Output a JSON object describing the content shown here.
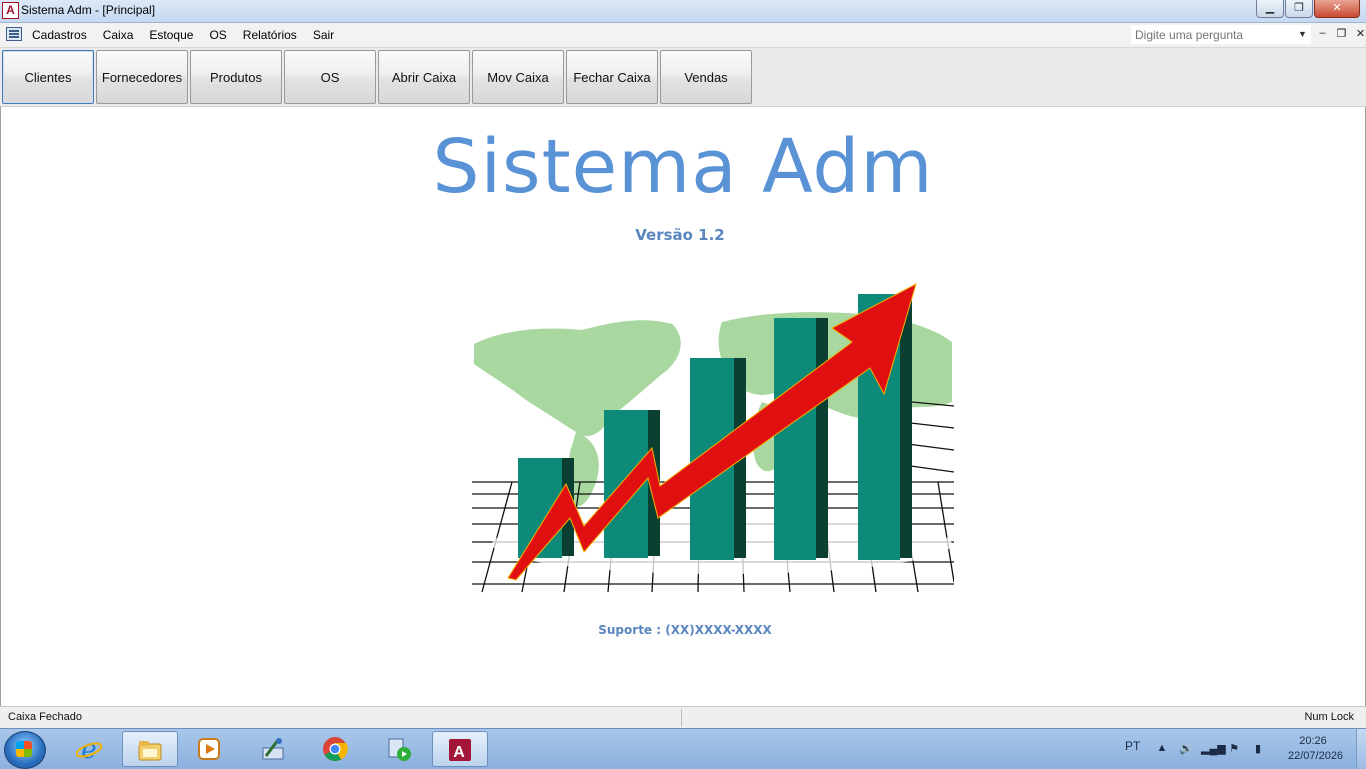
{
  "window": {
    "title": "Sistema Adm - [Principal]",
    "app_icon_letter": "A"
  },
  "menu": {
    "items": [
      "Cadastros",
      "Caixa",
      "Estoque",
      "OS",
      "Relatórios",
      "Sair"
    ],
    "ask_placeholder": "Digite uma pergunta"
  },
  "commands": {
    "buttons": [
      "Clientes",
      "Fornecedores",
      "Produtos",
      "OS",
      "Abrir Caixa",
      "Mov Caixa",
      "Fechar Caixa",
      "Vendas"
    ],
    "active": "Clientes"
  },
  "main": {
    "title": "Sistema Adm",
    "version": "Versão 1.2",
    "support": "Suporte : (XX)XXXX-XXXX",
    "image": "growth-chart-world-map",
    "colors": {
      "title": "#5a92d6",
      "bars": "#0e8a78",
      "arrow": "#e01010",
      "map": "#a8d8a0"
    }
  },
  "statusbar": {
    "left": "Caixa Fechado",
    "right": "Num Lock"
  },
  "taskbar": {
    "apps": [
      "internet-explorer-icon",
      "file-explorer-icon",
      "media-player-icon",
      "control-panel-icon",
      "chrome-icon",
      "media-center-icon",
      "access-icon"
    ],
    "active_app": "access-icon",
    "language": "PT",
    "time": "20:26",
    "date": "22/07/2026"
  }
}
